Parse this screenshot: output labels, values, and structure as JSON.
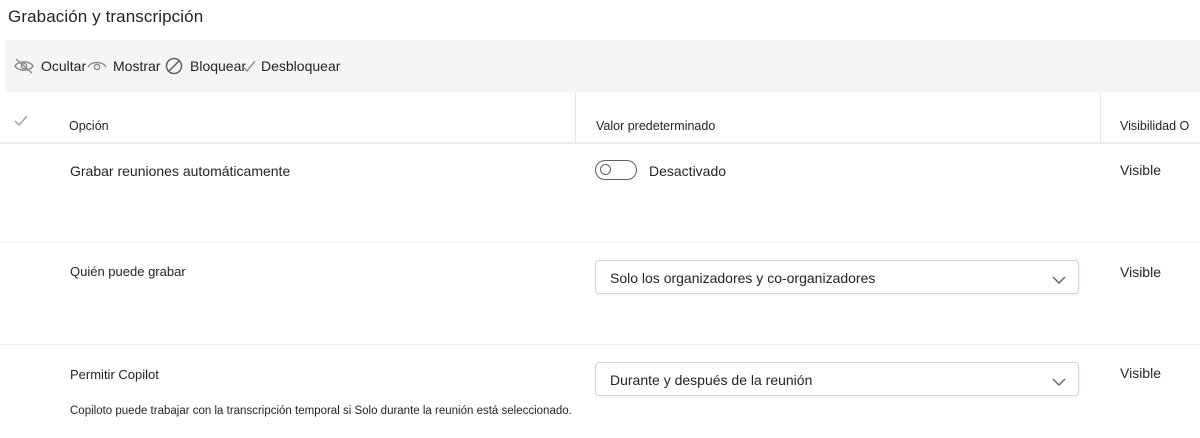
{
  "page": {
    "title": "Grabación y transcripción"
  },
  "toolbar": {
    "hide_label": "Ocultar",
    "show_label": "Mostrar",
    "block_label": "Bloquear",
    "unblock_label": "Desbloquear"
  },
  "table": {
    "headers": {
      "option": "Opción",
      "default_value": "Valor predeterminado",
      "visibility": "Visibilidad O"
    },
    "rows": [
      {
        "option": "Grabar reuniones automáticamente",
        "control": "toggle",
        "toggle_on": false,
        "value": "Desactivado",
        "visibility": "Visible"
      },
      {
        "option": "Quién puede grabar",
        "control": "dropdown",
        "value": "Solo los organizadores y co-organizadores",
        "visibility": "Visible"
      },
      {
        "option": "Permitir Copilot",
        "control": "dropdown",
        "value": "Durante y después de la reunión",
        "visibility": "Visible",
        "note": "Copiloto puede trabajar con la transcripción temporal si Solo durante la reunión está seleccionado."
      }
    ]
  },
  "icons": {
    "hide": "eye-off-icon",
    "show": "eye-icon",
    "block": "block-icon",
    "unblock": "checkmark-icon",
    "select_all": "checkmark-icon",
    "dropdown": "chevron-down-icon"
  },
  "colors": {
    "toolbar_bg": "#f5f5f5",
    "text": "#242424",
    "icon": "#616161",
    "divider": "#ececec"
  }
}
